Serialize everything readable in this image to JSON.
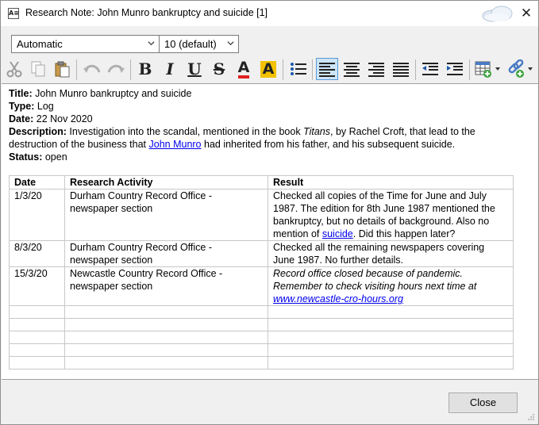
{
  "window": {
    "title": "Research Note:  John Munro bankruptcy and suicide [1]",
    "close_symbol": "✕"
  },
  "toolbar": {
    "font_value": "Automatic",
    "size_value": "10 (default)",
    "bold_label": "B",
    "italic_label": "I",
    "underline_label": "U",
    "strike_label": "S",
    "font_color_label": "A",
    "highlight_label": "A",
    "font_color": "#e02020",
    "highlight_color": "#f2c200"
  },
  "note": {
    "title_label": "Title:",
    "title_value": "John Munro bankruptcy and suicide",
    "type_label": "Type:",
    "type_value": "Log",
    "date_label": "Date:",
    "date_value": "22 Nov 2020",
    "description_label": "Description:",
    "description_pre": "Investigation into the scandal, mentioned in the book ",
    "description_book": "Titans",
    "description_mid": ", by Rachel Croft, that lead to the destruction of the business that ",
    "description_link": "John Munro",
    "description_post": " had inherited from his father, and his subsequent suicide.",
    "status_label": "Status:",
    "status_value": "open"
  },
  "log_table": {
    "headers": [
      "Date",
      "Research Activity",
      "Result"
    ],
    "rows": [
      {
        "date": "1/3/20",
        "activity": "Durham Country Record Office - newspaper section",
        "result_pre": "Checked all copies of the Time for June and July 1987.  The edition for 8th June 1987 mentioned the bankruptcy, but no details of background.  Also no mention of ",
        "result_link": "suicide",
        "result_post": ".  Did this happen later?"
      },
      {
        "date": "8/3/20",
        "activity": "Durham Country Record Office - newspaper section",
        "result_text": "Checked all the remaining newspapers covering June 1987.  No further details."
      },
      {
        "date": "15/3/20",
        "activity": "Newcastle Country Record Office - newspaper section",
        "result_italic": "Record office closed because of pandemic.  Remember to check visiting hours next time at ",
        "result_link": "www.newcastle-cro-hours.org"
      }
    ]
  },
  "footer": {
    "close_label": "Close"
  }
}
